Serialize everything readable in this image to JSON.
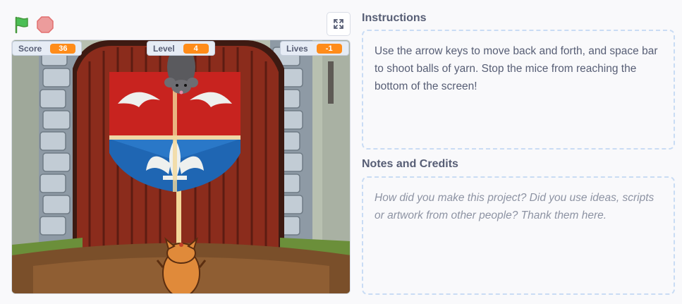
{
  "controls": {
    "green_flag_icon": "green-flag-icon",
    "stop_icon": "stop-sign-icon",
    "fullscreen_icon": "fullscreen-icon"
  },
  "monitors": {
    "score": {
      "label": "Score",
      "value": "36"
    },
    "level": {
      "label": "Level",
      "value": "4"
    },
    "lives": {
      "label": "Lives",
      "value": "-1"
    }
  },
  "instructions": {
    "title": "Instructions",
    "text": "Use the arrow keys to move back and forth, and space bar to shoot balls of yarn. Stop the mice from reaching the bottom of the screen!"
  },
  "notes": {
    "title": "Notes and Credits",
    "placeholder": "How did you make this project? Did you use ideas, scripts or artwork from other people? Thank them here."
  },
  "colors": {
    "monitor_value": "#ff8c1a",
    "text": "#575e75",
    "dashed_border": "#c9dcf4"
  }
}
